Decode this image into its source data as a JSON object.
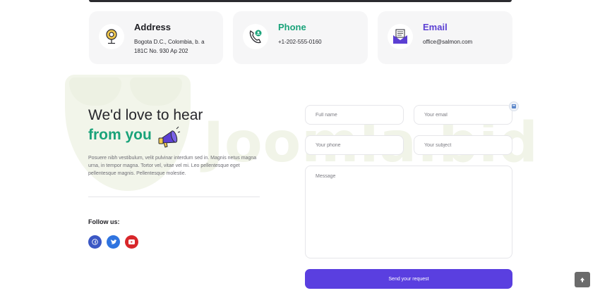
{
  "contact_cards": {
    "address": {
      "title": "Address",
      "text": "Bogota D.C., Colombia, b. a 181C No. 930 Ap 202",
      "icon": "map-pin-icon"
    },
    "phone": {
      "title": "Phone",
      "text": "+1-202-555-0160",
      "icon": "phone-icon"
    },
    "email": {
      "title": "Email",
      "text": "office@salmon.com",
      "icon": "envelope-icon"
    }
  },
  "intro": {
    "headline_line1": "We'd love to hear",
    "headline_line2": "from you",
    "body": "Posuere nibh vestibulum, velit pulvinar interdum sed in. Magnis netus magna urna, in tempor magna. Tortor vel, vitae vel mi. Leo pellentesque eget pellentesque magnis. Pellentesque molestie."
  },
  "follow": {
    "label": "Follow us:",
    "networks": [
      "facebook-icon",
      "twitter-icon",
      "youtube-icon"
    ]
  },
  "form": {
    "full_name_placeholder": "Full name",
    "email_placeholder": "Your email",
    "phone_placeholder": "Your phone",
    "subject_placeholder": "Your subject",
    "message_placeholder": "Message",
    "submit_label": "Send your request"
  },
  "watermark": {
    "text": "Joomla.bid"
  },
  "colors": {
    "green_accent": "#1aa37a",
    "purple_accent": "#5a3fe0",
    "card_bg": "#f6f6f7",
    "facebook": "#3b57c4",
    "twitter": "#2f74e0",
    "youtube": "#d8262a"
  }
}
